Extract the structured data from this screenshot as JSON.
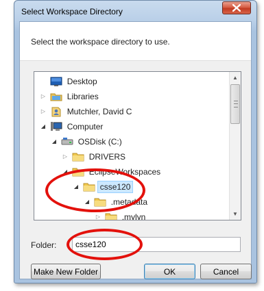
{
  "window": {
    "title": "Select Workspace Directory"
  },
  "dialog": {
    "instruction": "Select the workspace directory to use."
  },
  "tree": {
    "items": [
      {
        "label": "Desktop",
        "icon": "desktop-icon",
        "expander": ""
      },
      {
        "label": "Libraries",
        "icon": "libraries-icon",
        "expander": "collapsed"
      },
      {
        "label": "Mutchler, David C",
        "icon": "user-folder-icon",
        "expander": "collapsed"
      },
      {
        "label": "Computer",
        "icon": "computer-icon",
        "expander": "expanded"
      },
      {
        "label": "OSDisk (C:)",
        "icon": "drive-icon",
        "expander": "expanded"
      },
      {
        "label": "DRIVERS",
        "icon": "folder-icon",
        "expander": "collapsed"
      },
      {
        "label": "EclipseWorkspaces",
        "icon": "folder-icon",
        "expander": "expanded"
      },
      {
        "label": "csse120",
        "icon": "folder-icon",
        "expander": "expanded",
        "selected": true
      },
      {
        "label": ".metadata",
        "icon": "folder-icon",
        "expander": "expanded"
      },
      {
        "label": ".mylyn",
        "icon": "folder-icon",
        "expander": "collapsed"
      }
    ]
  },
  "folder": {
    "label": "Folder:",
    "value": "csse120"
  },
  "buttons": {
    "make_new_folder": "Make New Folder",
    "ok": "OK",
    "cancel": "Cancel"
  },
  "colors": {
    "annotation": "#e3110c",
    "selection": "#cce8ff",
    "folder": "#f2c94c"
  }
}
